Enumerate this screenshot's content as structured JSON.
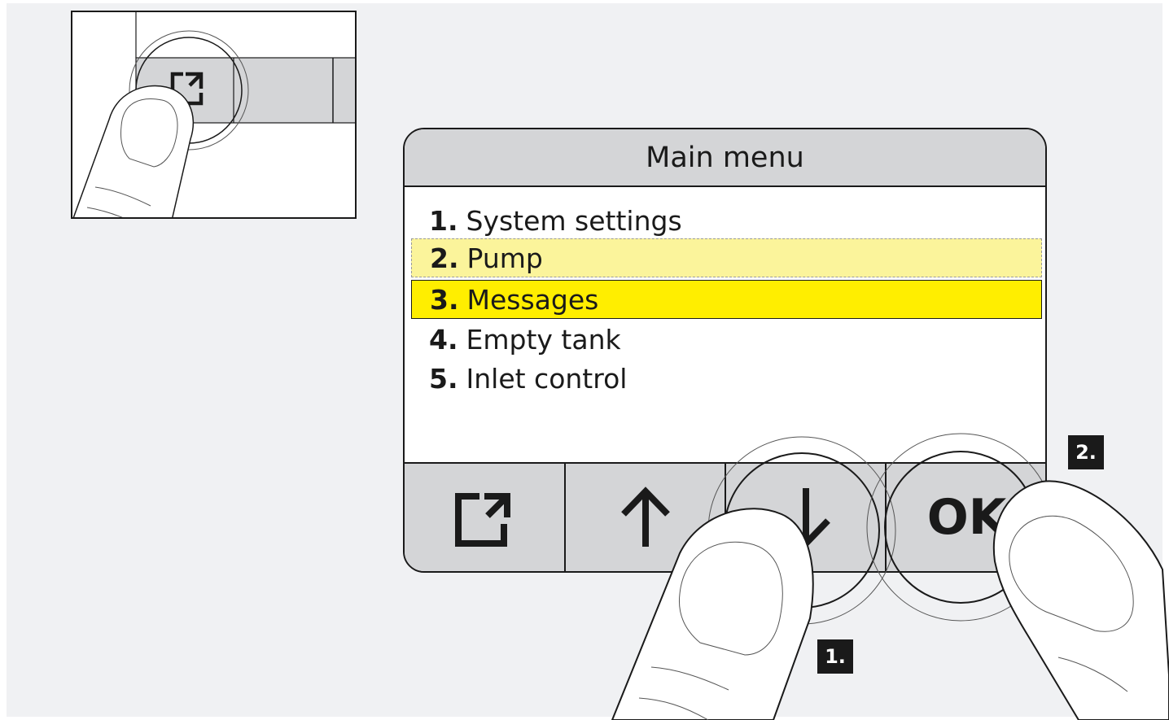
{
  "screen": {
    "title": "Main menu",
    "items": [
      {
        "num": "1.",
        "label": "System settings"
      },
      {
        "num": "2.",
        "label": "Pump"
      },
      {
        "num": "3.",
        "label": "Messages"
      },
      {
        "num": "4.",
        "label": "Empty tank"
      },
      {
        "num": "5.",
        "label": "Inlet control"
      }
    ],
    "highlight_previous_item": "2.",
    "selected_item": "3."
  },
  "softkeys": {
    "exit_icon": "exit-icon",
    "up_icon": "arrow-up-icon",
    "down_icon": "arrow-down-icon",
    "ok_label": "OK"
  },
  "steps": {
    "step1": "1.",
    "step2": "2."
  },
  "colors": {
    "background": "#f0f1f3",
    "header": "#d4d5d7",
    "selected": "#ffee00",
    "previous": "#fbf49b"
  }
}
